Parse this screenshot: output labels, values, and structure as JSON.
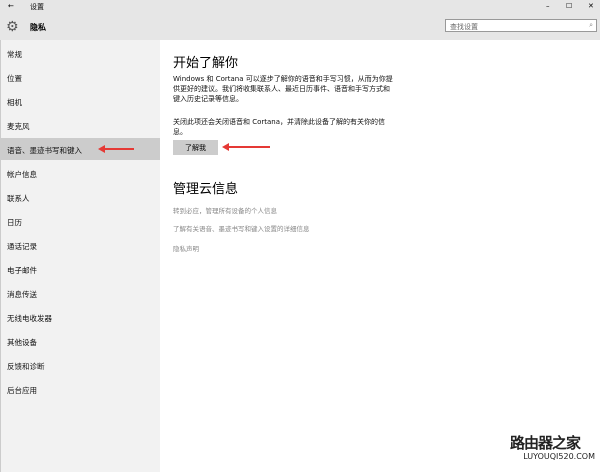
{
  "window": {
    "title": "设置",
    "back": "←",
    "minimize": "–",
    "maximize": "☐",
    "close": "✕"
  },
  "header": {
    "title": "隐私",
    "search_placeholder": "查找设置"
  },
  "sidebar": {
    "items": [
      {
        "label": "常规"
      },
      {
        "label": "位置"
      },
      {
        "label": "相机"
      },
      {
        "label": "麦克风"
      },
      {
        "label": "语音、墨迹书写和键入",
        "selected": true
      },
      {
        "label": "帐户信息"
      },
      {
        "label": "联系人"
      },
      {
        "label": "日历"
      },
      {
        "label": "通话记录"
      },
      {
        "label": "电子邮件"
      },
      {
        "label": "消息传送"
      },
      {
        "label": "无线电收发器"
      },
      {
        "label": "其他设备"
      },
      {
        "label": "反馈和诊断"
      },
      {
        "label": "后台应用"
      }
    ]
  },
  "main": {
    "section1": {
      "title": "开始了解你",
      "desc": "Windows 和 Cortana 可以逐步了解你的语音和手写习惯，从而为你提供更好的建议。我们将收集联系人、最近日历事件、语音和手写方式和键入历史记录等信息。",
      "note": "关闭此项还会关闭语音和 Cortana，并清除此设备了解的有关你的信息。",
      "button": "了解我"
    },
    "section2": {
      "title": "管理云信息",
      "links": [
        "转到必应，管理所有设备的个人信息",
        "了解有关语音、墨迹书写和键入设置的详细信息",
        "隐私声明"
      ]
    }
  },
  "watermark": {
    "name": "路由器之家",
    "url": "LUYOUQI520.COM"
  },
  "colors": {
    "accent_arrow": "#e53935",
    "selected": "#cccccc"
  }
}
